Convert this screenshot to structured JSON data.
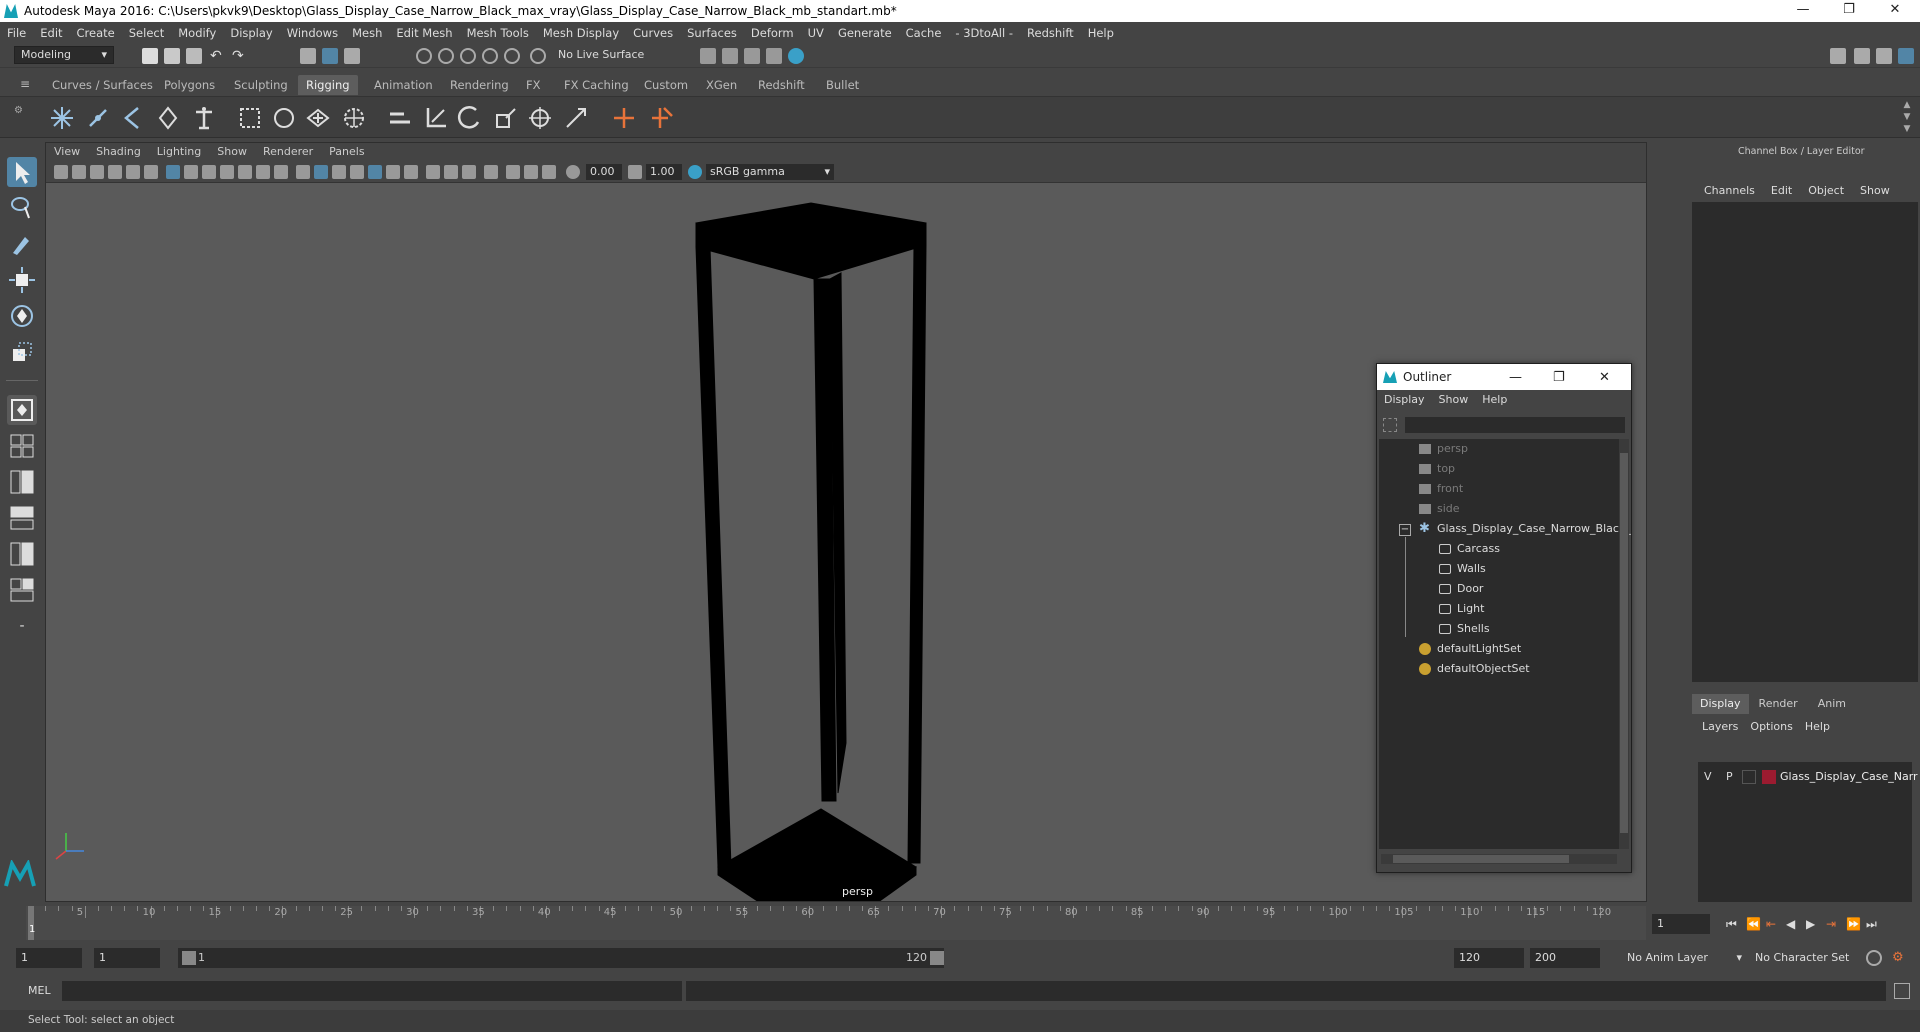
{
  "window": {
    "title": "Autodesk Maya 2016: C:\\Users\\pkvk9\\Desktop\\Glass_Display_Case_Narrow_Black_max_vray\\Glass_Display_Case_Narrow_Black_mb_standart.mb*",
    "minimize": "—",
    "maximize": "❐",
    "close": "✕"
  },
  "menubar": [
    "File",
    "Edit",
    "Create",
    "Select",
    "Modify",
    "Display",
    "Windows",
    "Mesh",
    "Edit Mesh",
    "Mesh Tools",
    "Mesh Display",
    "Curves",
    "Surfaces",
    "Deform",
    "UV",
    "Generate",
    "Cache",
    "- 3DtoAll -",
    "Redshift",
    "Help"
  ],
  "toolbar": {
    "mode": "Modeling",
    "live_surface": "No Live Surface"
  },
  "shelf_tabs": {
    "items": [
      "Curves / Surfaces",
      "Polygons",
      "Sculpting",
      "Rigging",
      "Animation",
      "Rendering",
      "FX",
      "FX Caching",
      "Custom",
      "XGen",
      "Redshift",
      "Bullet"
    ],
    "active": "Rigging"
  },
  "viewport": {
    "menu": [
      "View",
      "Shading",
      "Lighting",
      "Show",
      "Renderer",
      "Panels"
    ],
    "exposure": "0.00",
    "gamma": "1.00",
    "color_space": "sRGB gamma",
    "camera_label": "persp"
  },
  "outliner": {
    "title": "Outliner",
    "menu": [
      "Display",
      "Show",
      "Help"
    ],
    "items": [
      {
        "label": "persp",
        "dim": true
      },
      {
        "label": "top",
        "dim": true
      },
      {
        "label": "front",
        "dim": true
      },
      {
        "label": "side",
        "dim": true
      },
      {
        "label": "Glass_Display_Case_Narrow_Black_",
        "dim": false
      },
      {
        "label": "Carcass",
        "dim": false
      },
      {
        "label": "Walls",
        "dim": false
      },
      {
        "label": "Door",
        "dim": false
      },
      {
        "label": "Light",
        "dim": false
      },
      {
        "label": "Shells",
        "dim": false
      },
      {
        "label": "defaultLightSet",
        "dim": false
      },
      {
        "label": "defaultObjectSet",
        "dim": false
      }
    ]
  },
  "channel_box": {
    "title": "Channel Box / Layer Editor",
    "menu": [
      "Channels",
      "Edit",
      "Object",
      "Show"
    ]
  },
  "layer_editor": {
    "tabs": [
      "Display",
      "Render",
      "Anim"
    ],
    "menu": [
      "Layers",
      "Options",
      "Help"
    ],
    "layer": {
      "v": "V",
      "p": "P",
      "name": "Glass_Display_Case_Narr",
      "color": "#9b1b30"
    }
  },
  "timeline": {
    "ticks": [
      "5",
      "10",
      "15",
      "20",
      "25",
      "30",
      "35",
      "40",
      "45",
      "50",
      "55",
      "60",
      "65",
      "70",
      "75",
      "80",
      "85",
      "90",
      "95",
      "100",
      "105",
      "110",
      "115",
      "120"
    ],
    "current_frame_marker": "1",
    "current_frame": "1"
  },
  "range": {
    "start": "1",
    "playback_start": "1",
    "slider_start": "1",
    "slider_end": "120",
    "playback_end": "120",
    "end": "200",
    "anim_layer": "No Anim Layer",
    "character_set": "No Character Set"
  },
  "command": {
    "label": "MEL"
  },
  "help_line": "Select Tool: select an object",
  "colors": {
    "accent": "#5285a6",
    "bg": "#444444",
    "field": "#2b2b2b"
  }
}
